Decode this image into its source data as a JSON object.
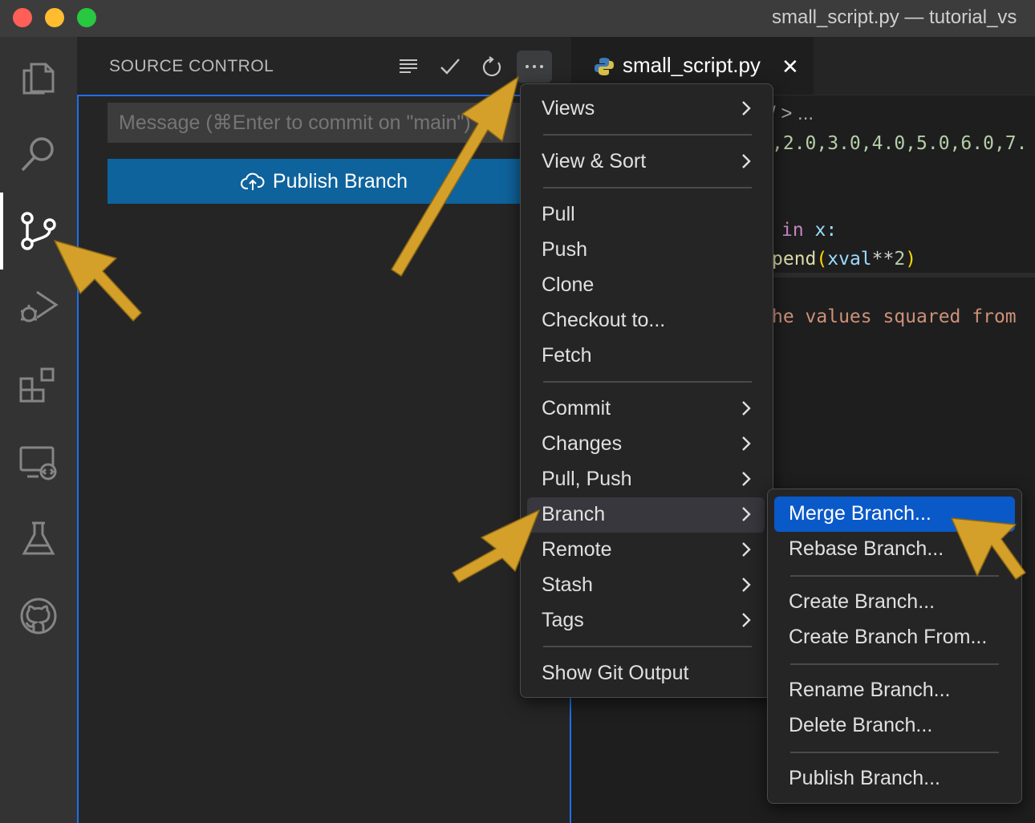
{
  "window": {
    "title": "small_script.py — tutorial_vs"
  },
  "sidebar": {
    "title": "SOURCE CONTROL",
    "commit_placeholder": "Message (⌘Enter to commit on \"main\")",
    "publish_label": "Publish Branch"
  },
  "editor": {
    "tab_label": "small_script.py",
    "breadcrumb": "/ > ...",
    "code_line_1": ",2.0,3.0,4.0,5.0,6.0,7.",
    "code_line_2_kw": "in",
    "code_line_2_var": " x:",
    "code_line_3_fn": "pend",
    "code_line_3_p1": "(",
    "code_line_3_var": "xval",
    "code_line_3_op": "**",
    "code_line_3_num": "2",
    "code_line_3_p2": ")",
    "code_comment": "he values squared from"
  },
  "menu": {
    "items": [
      {
        "label": "Views"
      },
      {
        "label": "View & Sort"
      },
      {
        "label": "Pull"
      },
      {
        "label": "Push"
      },
      {
        "label": "Clone"
      },
      {
        "label": "Checkout to..."
      },
      {
        "label": "Fetch"
      },
      {
        "label": "Commit"
      },
      {
        "label": "Changes"
      },
      {
        "label": "Pull, Push"
      },
      {
        "label": "Branch"
      },
      {
        "label": "Remote"
      },
      {
        "label": "Stash"
      },
      {
        "label": "Tags"
      },
      {
        "label": "Show Git Output"
      }
    ]
  },
  "submenu": {
    "items": [
      {
        "label": "Merge Branch..."
      },
      {
        "label": "Rebase Branch..."
      },
      {
        "label": "Create Branch..."
      },
      {
        "label": "Create Branch From..."
      },
      {
        "label": "Rename Branch..."
      },
      {
        "label": "Delete Branch..."
      },
      {
        "label": "Publish Branch..."
      }
    ]
  },
  "colors": {
    "accent": "#0a59c8",
    "publish_button": "#0e639c",
    "annotation_arrow": "#d4a02a"
  }
}
